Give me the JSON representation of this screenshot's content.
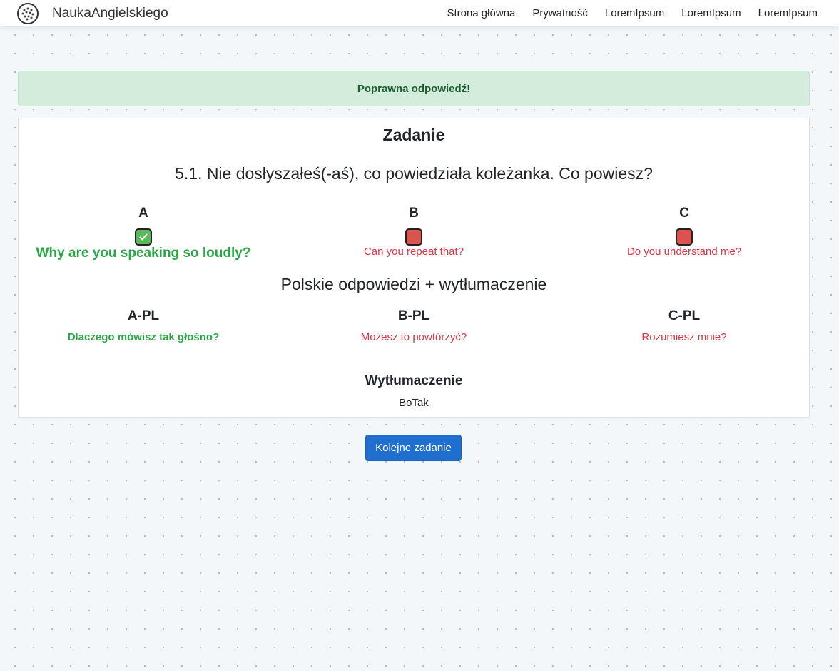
{
  "navbar": {
    "brand": "NaukaAngielskiego",
    "logo_icon": "dotted-globe-icon",
    "links": [
      "Strona główna",
      "Prywatność",
      "LoremIpsum",
      "LoremIpsum",
      "LoremIpsum"
    ]
  },
  "alert": {
    "text": "Poprawna odpowiedź!",
    "color": "#d4ecdc"
  },
  "task": {
    "title": "Zadanie",
    "question": "5.1. Nie dosłyszałeś(-aś), co powiedziała koleżanka. Co powiesz?",
    "options": [
      {
        "letter": "A",
        "text": "Why are you speaking so loudly?",
        "state": "correct",
        "icon": "check-icon"
      },
      {
        "letter": "B",
        "text": "Can you repeat that?",
        "state": "wrong",
        "icon": "none"
      },
      {
        "letter": "C",
        "text": "Do you understand me?",
        "state": "wrong",
        "icon": "none"
      }
    ],
    "pl_title": "Polskie odpowiedzi + wytłumaczenie",
    "pl_options": [
      {
        "letter": "A-PL",
        "text": "Dlaczego mówisz tak głośno?"
      },
      {
        "letter": "B-PL",
        "text": "Możesz to powtórzyć?"
      },
      {
        "letter": "C-PL",
        "text": "Rozumiesz mnie?"
      }
    ],
    "explanation_title": "Wytłumaczenie",
    "explanation_text": "BoTak"
  },
  "next_button": {
    "label": "Kolejne zadanie",
    "color": "#1e6fd0"
  },
  "colors": {
    "correct": "#28a745",
    "wrong": "#dc3545"
  }
}
